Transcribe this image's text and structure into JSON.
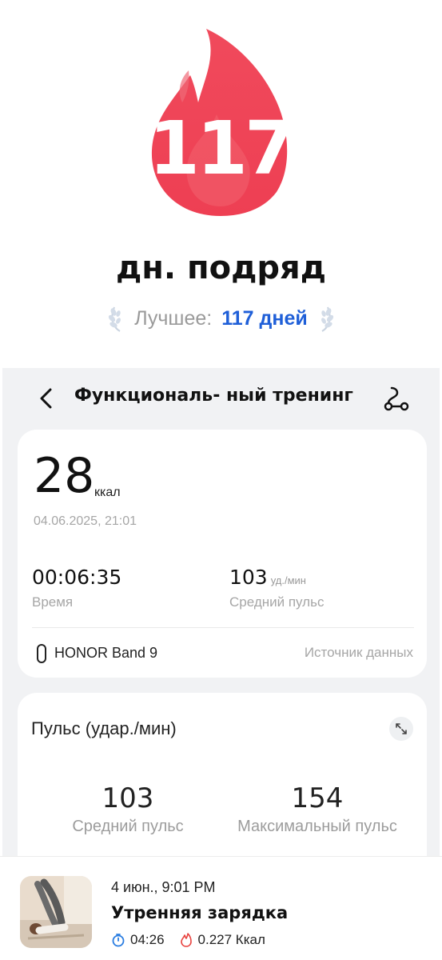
{
  "streak": {
    "days": "117",
    "label": "дн. подряд",
    "best_label": "Лучшее:",
    "best_value": "117 дней",
    "flame_color": "#ee4357"
  },
  "workout": {
    "title": "Функциональ- ный тренинг",
    "calories": "28",
    "calories_unit": "ккал",
    "datetime": "04.06.2025, 21:01",
    "duration": "00:06:35",
    "duration_label": "Время",
    "avg_pulse": "103",
    "avg_pulse_unit": "уд./мин",
    "avg_pulse_label": "Средний пульс",
    "device": "HONOR Band 9",
    "source_label": "Источник данных"
  },
  "pulse_card": {
    "title": "Пульс (удар./мин)",
    "avg_value": "103",
    "avg_label": "Средний пульс",
    "max_value": "154",
    "max_label": "Максимальный пульс"
  },
  "list_item": {
    "date": "4 июн., 9:01 PM",
    "title": "Утренняя зарядка",
    "duration": "04:26",
    "calories": "0.227 Ккал",
    "timer_icon_color": "#2a7de1",
    "fire_icon_color": "#e8423e"
  },
  "icons": [
    "flame-icon",
    "laurel-icon",
    "back-arrow-icon",
    "route-icon",
    "watch-icon",
    "expand-icon",
    "timer-icon",
    "fire-icon"
  ]
}
